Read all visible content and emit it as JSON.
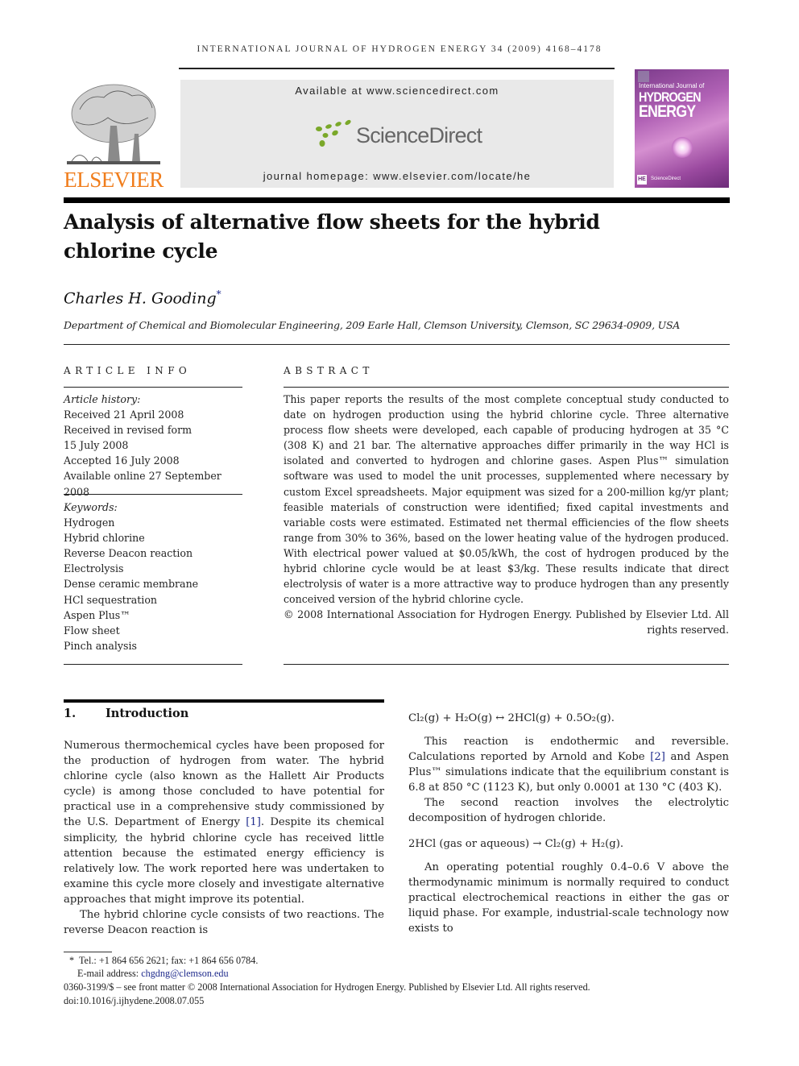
{
  "header": {
    "running_head": "INTERNATIONAL JOURNAL OF HYDROGEN ENERGY 34 (2009) 4168–4178",
    "publisher_logo": "ELSEVIER",
    "available_at": "Available at www.sciencedirect.com",
    "sciencedirect_logo": "ScienceDirect",
    "journal_homepage": "journal homepage: www.elsevier.com/locate/he",
    "cover": {
      "line1": "International Journal of",
      "line2": "HYDROGEN",
      "line3": "ENERGY",
      "badge": "HE",
      "footer": "ScienceDirect"
    },
    "colors": {
      "elsevier_orange": "#f07d1c",
      "sciencedirect_green": "#7aa829",
      "sciencedirect_gray": "#666666",
      "link_blue": "#1f2b8c",
      "cover_purple": "#9b4aa0"
    }
  },
  "article": {
    "title_line1": "Analysis of alternative flow sheets for the hybrid",
    "title_line2": "chlorine cycle",
    "author": "Charles H. Gooding",
    "author_mark": "*",
    "affiliation": "Department of Chemical and Biomolecular Engineering, 209 Earle Hall, Clemson University, Clemson, SC 29634-0909, USA"
  },
  "article_info": {
    "heading": "ARTICLE INFO",
    "history_label": "Article history:",
    "history": [
      "Received 21 April 2008",
      "Received in revised form",
      "15 July 2008",
      "Accepted 16 July 2008",
      "Available online 27 September 2008"
    ],
    "keywords_label": "Keywords:",
    "keywords": [
      "Hydrogen",
      "Hybrid chlorine",
      "Reverse Deacon reaction",
      "Electrolysis",
      "Dense ceramic membrane",
      "HCl sequestration",
      "Aspen Plus™",
      "Flow sheet",
      "Pinch analysis"
    ]
  },
  "abstract": {
    "heading": "ABSTRACT",
    "text": "This paper reports the results of the most complete conceptual study conducted to date on hydrogen production using the hybrid chlorine cycle. Three alternative process flow sheets were developed, each capable of producing hydrogen at 35 °C (308 K) and 21 bar. The alternative approaches differ primarily in the way HCl is isolated and converted to hydrogen and chlorine gases. Aspen Plus™ simulation software was used to model the unit processes, supplemented where necessary by custom Excel spreadsheets. Major equipment was sized for a 200-million kg/yr plant; feasible materials of construction were identified; fixed capital investments and variable costs were estimated. Estimated net thermal efficiencies of the flow sheets range from 30% to 36%, based on the lower heating value of the hydrogen produced. With electrical power valued at $0.05/kWh, the cost of hydrogen produced by the hybrid chlorine cycle would be at least $3/kg. These results indicate that direct electrolysis of water is a more attractive way to produce hydrogen than any presently conceived version of the hybrid chlorine cycle.",
    "copyright": "© 2008 International Association for Hydrogen Energy. Published by Elsevier Ltd. All rights reserved."
  },
  "introduction": {
    "number": "1.",
    "title": "Introduction",
    "p1_a": "Numerous thermochemical cycles have been proposed for the production of hydrogen from water. The hybrid chlorine cycle (also known as the Hallett Air Products cycle) is among those concluded to have potential for practical use in a comprehensive study commissioned by the U.S. Department of Energy ",
    "p1_cite": "[1]",
    "p1_b": ". Despite its chemical simplicity, the hybrid chlorine cycle has received little attention because the estimated energy efficiency is relatively low. The work reported here was undertaken to examine this cycle more closely and investigate alternative approaches that might improve its potential.",
    "p2": "The hybrid chlorine cycle consists of two reactions. The reverse Deacon reaction is",
    "eq1": "Cl₂(g) + H₂O(g) ↔ 2HCl(g) + 0.5O₂(g).",
    "p3_a": "This reaction is endothermic and reversible. Calculations reported by Arnold and Kobe ",
    "p3_cite": "[2]",
    "p3_b": " and Aspen Plus™ simulations indicate that the equilibrium constant is 6.8 at 850 °C (1123 K), but only 0.0001 at 130 °C (403 K).",
    "p4": "The second reaction involves the electrolytic decomposition of hydrogen chloride.",
    "eq2": "2HCl (gas or aqueous) → Cl₂(g) + H₂(g).",
    "p5": "An operating potential roughly 0.4–0.6 V above the thermodynamic minimum is normally required to conduct practical electrochemical reactions in either the gas or liquid phase. For example, industrial-scale technology now exists to"
  },
  "footnotes": {
    "contact_mark": "*",
    "contact": "Tel.: +1 864 656 2621; fax: +1 864 656 0784.",
    "email_label": "E-mail address: ",
    "email": "chgdng@clemson.edu",
    "front_matter": "0360-3199/$ – see front matter © 2008 International Association for Hydrogen Energy. Published by Elsevier Ltd. All rights reserved.",
    "doi": "doi:10.1016/j.ijhydene.2008.07.055"
  }
}
